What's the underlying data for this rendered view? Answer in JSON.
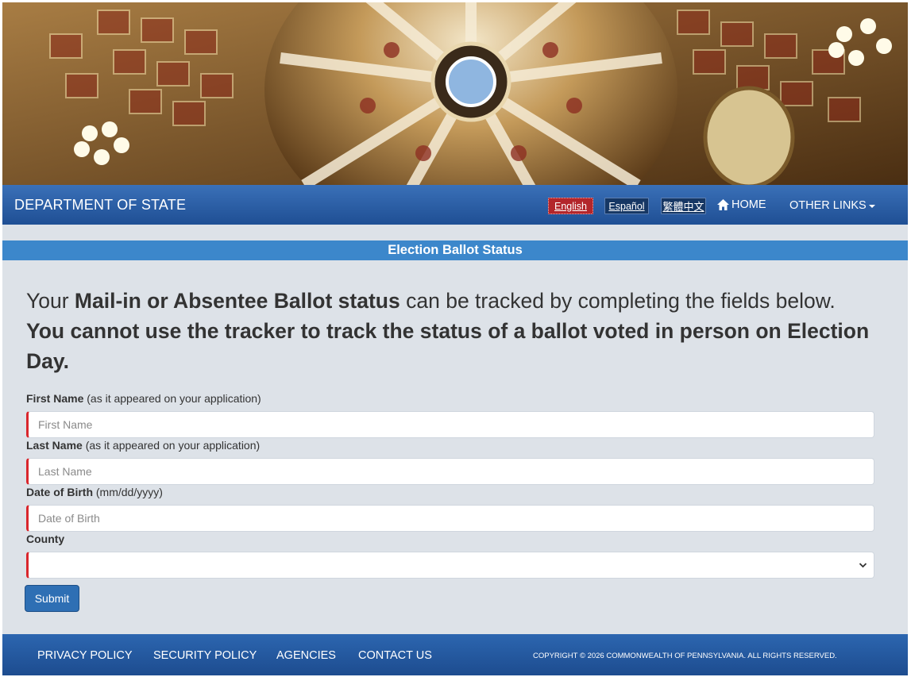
{
  "nav": {
    "brand": "DEPARTMENT OF STATE",
    "languages": [
      "English",
      "Español",
      "繁體中文"
    ],
    "home_label": "HOME",
    "other_links_label": "OTHER LINKS"
  },
  "page": {
    "title": "Election Ballot Status",
    "intro_prefix": "Your ",
    "intro_bold": "Mail-in or Absentee Ballot status",
    "intro_suffix": " can be tracked by completing the fields below.",
    "intro_warning": "You cannot use the tracker to track the status of a ballot voted in person on Election Day."
  },
  "form": {
    "first_name": {
      "label": "First Name",
      "hint": "(as it appeared on your application)",
      "placeholder": "First Name",
      "value": ""
    },
    "last_name": {
      "label": "Last Name",
      "hint": "(as it appeared on your application)",
      "placeholder": "Last Name",
      "value": ""
    },
    "dob": {
      "label": "Date of Birth",
      "hint": "(mm/dd/yyyy)",
      "placeholder": "Date of Birth",
      "value": ""
    },
    "county": {
      "label": "County",
      "selected": ""
    },
    "submit_label": "Submit"
  },
  "footer": {
    "links": [
      "PRIVACY POLICY",
      "SECURITY POLICY",
      "AGENCIES",
      "CONTACT US"
    ],
    "copyright": "COPYRIGHT © 2026 COMMONWEALTH OF PENNSYLVANIA. ALL RIGHTS RESERVED."
  },
  "colors": {
    "nav_bg": "#2a5ea6",
    "title_bar": "#3c87cb",
    "page_bg": "#dde2e8",
    "required_marker": "#d9262c",
    "english_active": "#b3262b",
    "submit_bg": "#2e6fb4"
  }
}
